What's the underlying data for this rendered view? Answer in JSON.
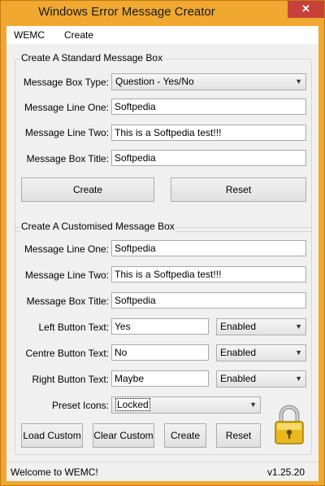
{
  "window": {
    "title": "Windows Error Message Creator",
    "close_glyph": "✕",
    "accent": "#f0a830"
  },
  "menu": {
    "items": [
      "WEMC",
      "Create"
    ]
  },
  "standard": {
    "group_title": "Create A Standard Message Box",
    "type_label": "Message Box Type:",
    "type_value": "Question - Yes/No",
    "line_one_label": "Message Line One:",
    "line_one_value": "Softpedia",
    "line_two_label": "Message Line Two:",
    "line_two_value": "This is a Softpedia test!!!",
    "title_label": "Message Box Title:",
    "title_value": "Softpedia",
    "create_label": "Create",
    "reset_label": "Reset"
  },
  "custom": {
    "group_title": "Create A Customised Message Box",
    "line_one_label": "Message Line One:",
    "line_one_value": "Softpedia",
    "line_two_label": "Message Line Two:",
    "line_two_value": "This is a Softpedia test!!!",
    "title_label": "Message Box Title:",
    "title_value": "Softpedia",
    "left_label": "Left Button Text:",
    "left_value": "Yes",
    "left_state": "Enabled",
    "centre_label": "Centre Button Text:",
    "centre_value": "No",
    "centre_state": "Enabled",
    "right_label": "Right Button Text:",
    "right_value": "Maybe",
    "right_state": "Enabled",
    "icons_label": "Preset Icons:",
    "icons_value": "Locked",
    "load_label": "Load Custom",
    "clear_label": "Clear Custom",
    "create_label": "Create",
    "reset_label": "Reset",
    "preview_icon": "padlock-icon"
  },
  "status": {
    "message": "Welcome to WEMC!",
    "version": "v1.25.20"
  }
}
